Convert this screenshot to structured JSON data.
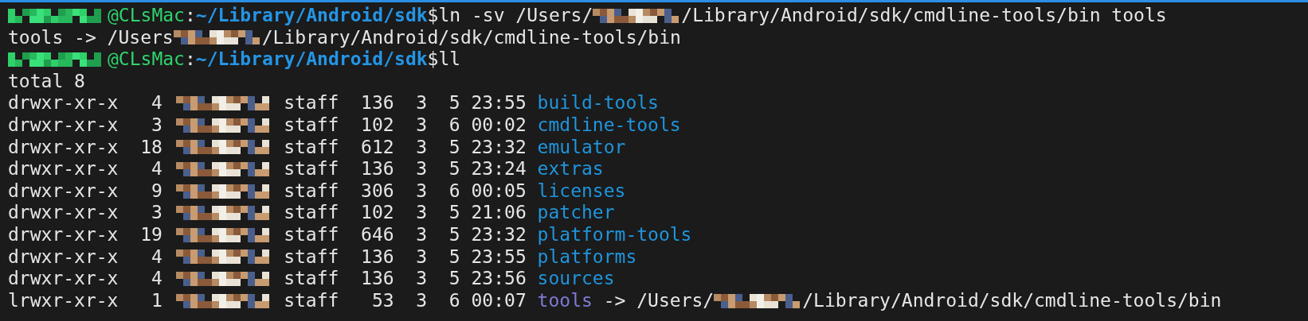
{
  "lines": [
    {
      "segments": [
        {
          "kind": "redacted_user"
        },
        {
          "kind": "host",
          "text": "@CLsMac"
        },
        {
          "kind": "plain",
          "text": ":"
        },
        {
          "kind": "cwd",
          "text": "~/Library/Android/sdk"
        },
        {
          "kind": "plain",
          "text": "$ln -sv /Users/"
        },
        {
          "kind": "redacted"
        },
        {
          "kind": "plain",
          "text": "/Library/Android/sdk/cmdline-tools/bin tools"
        }
      ]
    },
    {
      "segments": [
        {
          "kind": "plain",
          "text": "tools -> /Users"
        },
        {
          "kind": "redacted"
        },
        {
          "kind": "plain",
          "text": "/Library/Android/sdk/cmdline-tools/bin"
        }
      ]
    },
    {
      "segments": [
        {
          "kind": "redacted_user"
        },
        {
          "kind": "host",
          "text": "@CLsMac"
        },
        {
          "kind": "plain",
          "text": ":"
        },
        {
          "kind": "cwd",
          "text": "~/Library/Android/sdk"
        },
        {
          "kind": "plain",
          "text": "$ll"
        }
      ]
    },
    {
      "segments": [
        {
          "kind": "plain",
          "text": "total 8"
        }
      ]
    }
  ],
  "listing": [
    {
      "mode": "drwxr-xr-x",
      "links": "4",
      "group": "staff",
      "size": "136",
      "month": "3",
      "day": "5",
      "time": "23:55",
      "kind": "dir",
      "name": "build-tools"
    },
    {
      "mode": "drwxr-xr-x",
      "links": "3",
      "group": "staff",
      "size": "102",
      "month": "3",
      "day": "6",
      "time": "00:02",
      "kind": "dir",
      "name": "cmdline-tools"
    },
    {
      "mode": "drwxr-xr-x",
      "links": "18",
      "group": "staff",
      "size": "612",
      "month": "3",
      "day": "5",
      "time": "23:32",
      "kind": "dir",
      "name": "emulator"
    },
    {
      "mode": "drwxr-xr-x",
      "links": "4",
      "group": "staff",
      "size": "136",
      "month": "3",
      "day": "5",
      "time": "23:24",
      "kind": "dir",
      "name": "extras"
    },
    {
      "mode": "drwxr-xr-x",
      "links": "9",
      "group": "staff",
      "size": "306",
      "month": "3",
      "day": "6",
      "time": "00:05",
      "kind": "dir",
      "name": "licenses"
    },
    {
      "mode": "drwxr-xr-x",
      "links": "3",
      "group": "staff",
      "size": "102",
      "month": "3",
      "day": "5",
      "time": "21:06",
      "kind": "dir",
      "name": "patcher"
    },
    {
      "mode": "drwxr-xr-x",
      "links": "19",
      "group": "staff",
      "size": "646",
      "month": "3",
      "day": "5",
      "time": "23:32",
      "kind": "dir",
      "name": "platform-tools"
    },
    {
      "mode": "drwxr-xr-x",
      "links": "4",
      "group": "staff",
      "size": "136",
      "month": "3",
      "day": "5",
      "time": "23:55",
      "kind": "dir",
      "name": "platforms"
    },
    {
      "mode": "drwxr-xr-x",
      "links": "4",
      "group": "staff",
      "size": "136",
      "month": "3",
      "day": "5",
      "time": "23:56",
      "kind": "dir",
      "name": "sources"
    },
    {
      "mode": "lrwxr-xr-x",
      "links": "1",
      "group": "staff",
      "size": "53",
      "month": "3",
      "day": "6",
      "time": "00:07",
      "kind": "link",
      "name": "tools",
      "arrow": " -> /Users/",
      "target": "/Library/Android/sdk/cmdline-tools/bin"
    }
  ]
}
